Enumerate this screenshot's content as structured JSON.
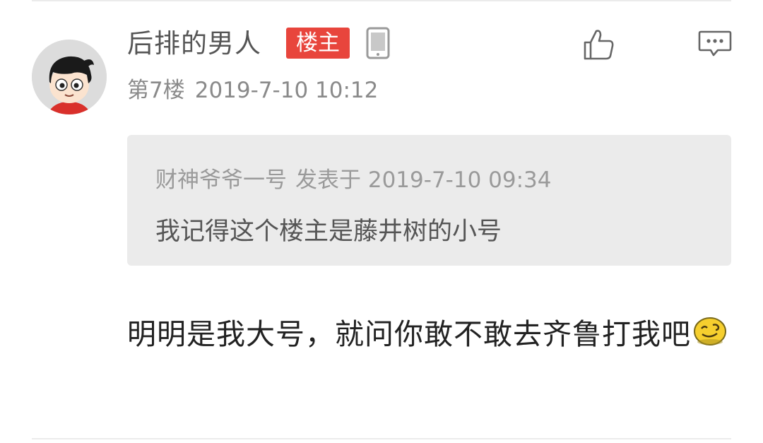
{
  "post": {
    "username": "后排的男人",
    "op_badge": "楼主",
    "floor": "第7楼",
    "timestamp": "2019-7-10 10:12",
    "icons": {
      "device": "mobile-phone-icon",
      "like": "thumbs-up-icon",
      "reply": "comment-icon",
      "emoji": "wink-emoji-icon"
    },
    "quote": {
      "author": "财神爷爷一号",
      "label": "发表于",
      "time": "2019-7-10 09:34",
      "text": "我记得这个楼主是藤井树的小号"
    },
    "content": "明明是我大号，就问你敢不敢去齐鲁打我吧"
  },
  "colors": {
    "badge": "#e8453c",
    "quote_bg": "#ebebeb",
    "meta_text": "#8a8a8a"
  }
}
